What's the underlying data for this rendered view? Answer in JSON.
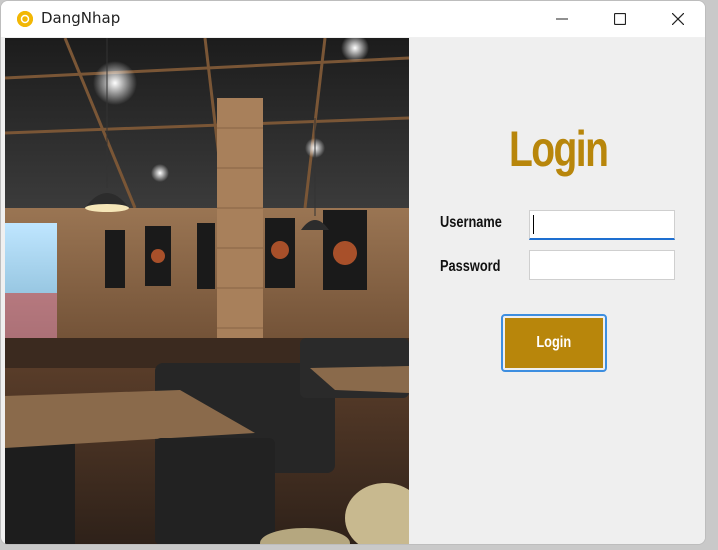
{
  "window": {
    "title": "DangNhap",
    "icon": "app-icon",
    "controls": [
      "minimize-icon",
      "maximize-icon",
      "close-icon"
    ]
  },
  "photo": {
    "alt_icon": "restaurant-photo"
  },
  "form": {
    "heading": "Login",
    "username_label": "Username",
    "password_label": "Password",
    "username_value": "",
    "password_value": "",
    "login_button": "Login"
  },
  "colors": {
    "accent": "#b8860b",
    "focus": "#1e6fd0",
    "panel": "#efefef"
  }
}
